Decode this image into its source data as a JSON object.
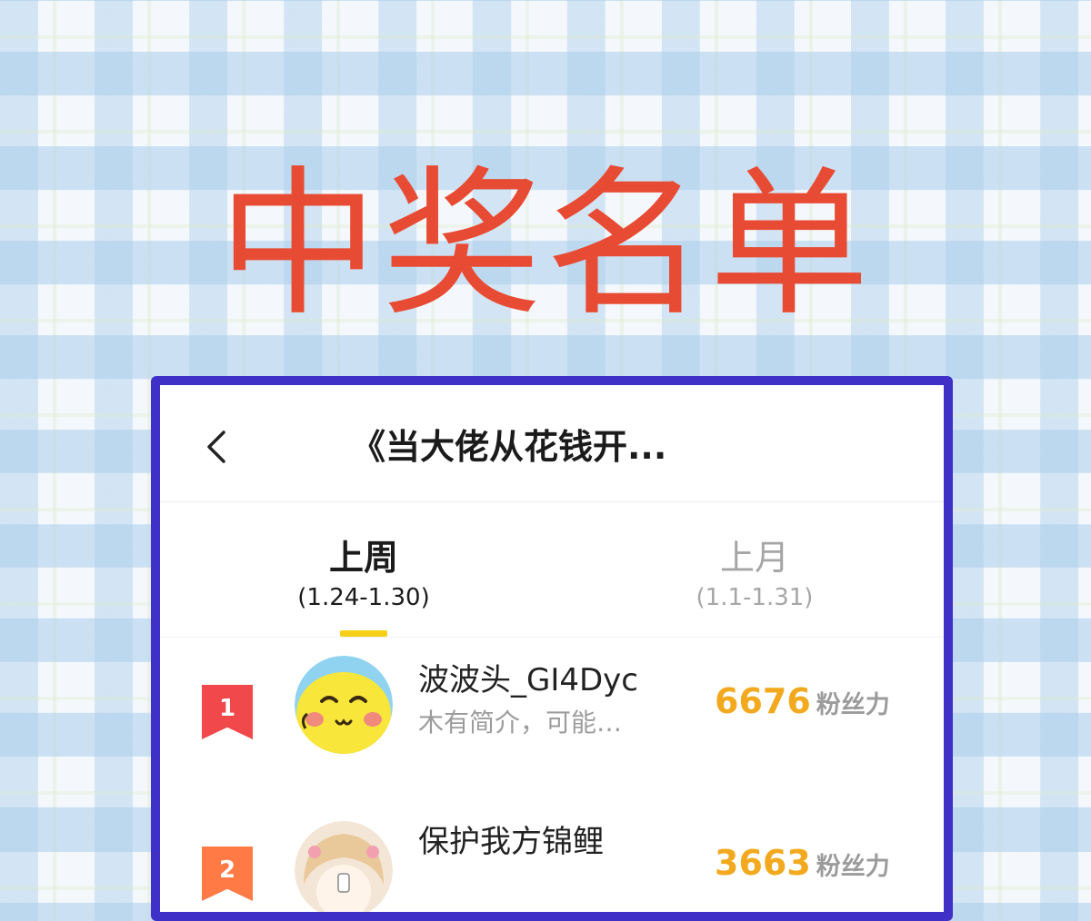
{
  "banner": {
    "title": "中奖名单"
  },
  "header": {
    "book_title": "《当大佬从花钱开..."
  },
  "tabs": [
    {
      "label": "上周",
      "range": "(1.24-1.30)",
      "active": true
    },
    {
      "label": "上月",
      "range": "(1.1-1.31)",
      "active": false
    }
  ],
  "ranking": [
    {
      "rank": "1",
      "name": "波波头_GI4Dyc",
      "bio": "木有简介，可能…",
      "score": "6676",
      "unit": "粉丝力",
      "badge_color": "#f0484b"
    },
    {
      "rank": "2",
      "name": "保护我方锦鲤",
      "bio": "",
      "score": "3663",
      "unit": "粉丝力",
      "badge_color": "#ff7a45"
    }
  ],
  "colors": {
    "accent": "#e84b33",
    "frame": "#3f31c8",
    "score": "#f2a91d",
    "tab_indicator": "#f5d016"
  },
  "icons": {
    "back": "chevron-left-icon"
  }
}
